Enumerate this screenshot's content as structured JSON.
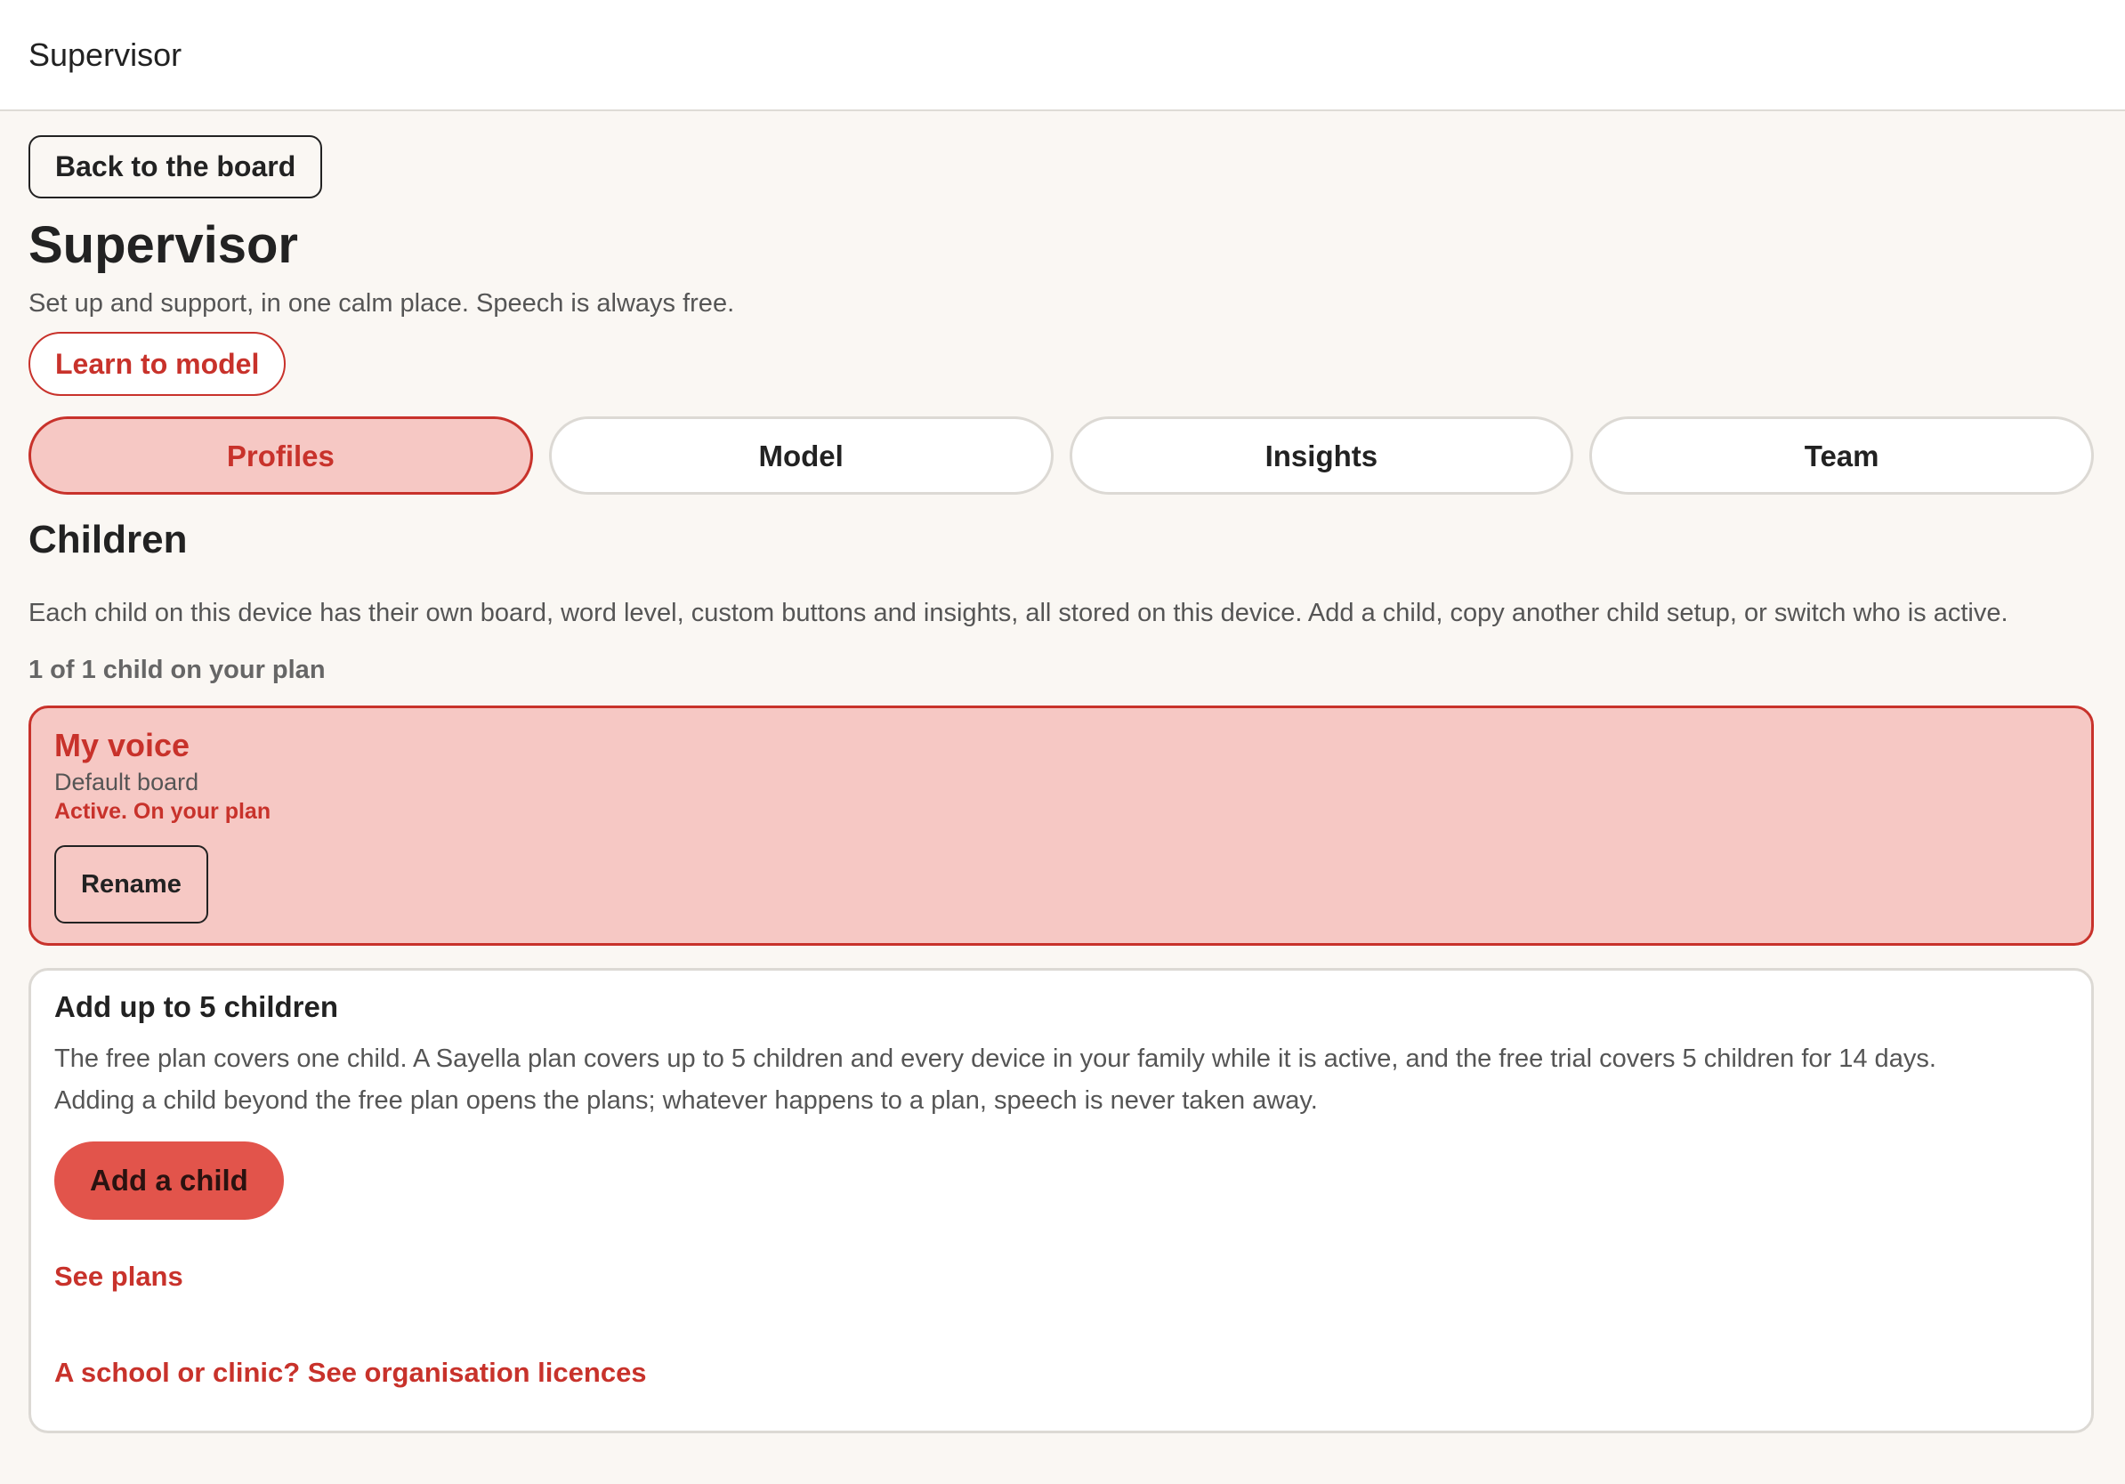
{
  "topbar": {
    "title": "Supervisor"
  },
  "back_button": "Back to the board",
  "page": {
    "title": "Supervisor",
    "subtitle": "Set up and support, in one calm place. Speech is always free.",
    "learn_button": "Learn to model"
  },
  "tabs": [
    {
      "label": "Profiles",
      "active": true
    },
    {
      "label": "Model",
      "active": false
    },
    {
      "label": "Insights",
      "active": false
    },
    {
      "label": "Team",
      "active": false
    }
  ],
  "children_section": {
    "title": "Children",
    "description": "Each child on this device has their own board, word level, custom buttons and insights, all stored on this device. Add a child, copy another child setup, or switch who is active.",
    "plan_count": "1 of 1 child on your plan"
  },
  "child_card": {
    "name": "My voice",
    "board": "Default board",
    "status": "Active. On your plan",
    "rename_button": "Rename"
  },
  "add_card": {
    "title": "Add up to 5 children",
    "description_line1": "The free plan covers one child. A Sayella plan covers up to 5 children and every device in your family while it is active, and the free trial covers 5 children for 14 days.",
    "description_line2": "Adding a child beyond the free plan opens the plans; whatever happens to a plan, speech is never taken away.",
    "add_button": "Add a child",
    "see_plans_link": "See plans",
    "org_link": "A school or clinic? See organisation licences"
  },
  "colors": {
    "accent": "#c8322b",
    "accent_fill": "#f6c8c4",
    "primary_button": "#e2544b",
    "background": "#faf7f3"
  }
}
